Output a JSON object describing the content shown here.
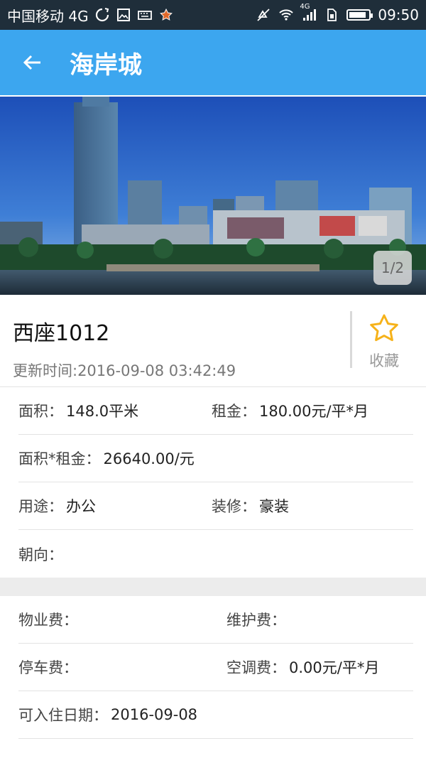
{
  "status_bar": {
    "carrier": "中国移动 4G",
    "time": "09:50",
    "net_badge": "4G",
    "battery_level": 0.9
  },
  "app_bar": {
    "title": "海岸城",
    "back_icon": "arrow-left-icon"
  },
  "hero": {
    "pager": "1/2"
  },
  "listing": {
    "name": "西座1012",
    "update_time": "更新时间:2016-09-08 03:42:49",
    "favorite_label": "收藏",
    "favorite_icon": "star-outline-icon",
    "favorite_color": "#f6b21a"
  },
  "details": {
    "area_label": "面积：",
    "area_value": "148.0平米",
    "rent_label": "租金：",
    "rent_value": "180.00元/平*月",
    "total_label": "面积*租金：",
    "total_value": "26640.00/元",
    "usage_label": "用途：",
    "usage_value": "办公",
    "decor_label": "装修：",
    "decor_value": "豪装",
    "orientation_label": "朝向："
  },
  "fees": {
    "property_label": "物业费：",
    "maintenance_label": "维护费：",
    "parking_label": "停车费：",
    "ac_label": "空调费：",
    "ac_value": "0.00元/平*月",
    "movein_label": "可入住日期：",
    "movein_value": "2016-09-08"
  },
  "colors": {
    "app_bar": "#3ca6ef",
    "status_bar": "#1f2e3a"
  }
}
